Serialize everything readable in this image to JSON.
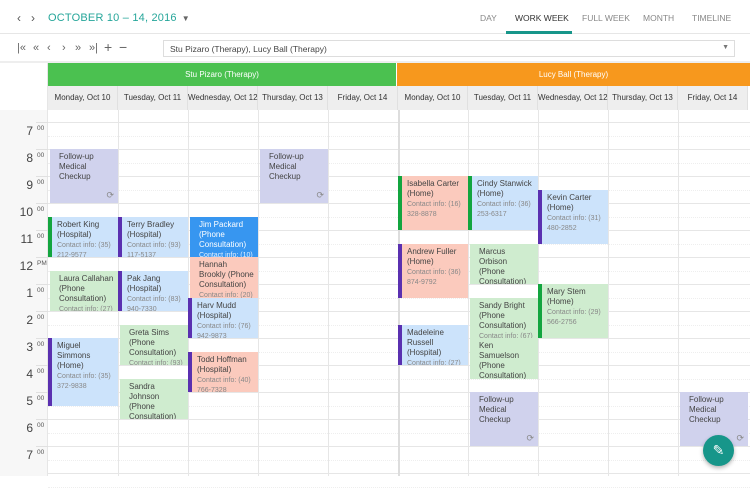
{
  "header": {
    "prev": "‹",
    "next": "›",
    "date_range": "OCTOBER 10 – 14, 2016",
    "views": [
      "DAY",
      "WORK WEEK",
      "FULL WEEK",
      "MONTH",
      "TIMELINE"
    ],
    "active_view": "WORK WEEK"
  },
  "toolbar": {
    "buttons": [
      "first",
      "prev-page",
      "prev",
      "next",
      "next-page",
      "last",
      "zoom-in",
      "zoom-out"
    ],
    "glyphs": [
      "|«",
      "«",
      "‹",
      "›",
      "»",
      "»|",
      "+",
      "−"
    ],
    "resources_value": "Stu Pizaro (Therapy), Lucy Ball (Therapy)"
  },
  "resources": [
    {
      "name": "Stu Pizaro (Therapy)",
      "color": "#4bc150"
    },
    {
      "name": "Lucy Ball (Therapy)",
      "color": "#f7981d"
    }
  ],
  "days": [
    "Monday, Oct 10",
    "Tuesday, Oct 11",
    "Wednesday, Oct 12",
    "Thursday, Oct 13",
    "Friday, Oct 14"
  ],
  "hours": [
    {
      "h": "7",
      "s": "00"
    },
    {
      "h": "8",
      "s": "00"
    },
    {
      "h": "9",
      "s": "00"
    },
    {
      "h": "10",
      "s": "00"
    },
    {
      "h": "11",
      "s": "00"
    },
    {
      "h": "12",
      "s": "PM"
    },
    {
      "h": "1",
      "s": "00"
    },
    {
      "h": "2",
      "s": "00"
    },
    {
      "h": "3",
      "s": "00"
    },
    {
      "h": "4",
      "s": "00"
    },
    {
      "h": "5",
      "s": "00"
    },
    {
      "h": "6",
      "s": "00"
    },
    {
      "h": "7",
      "s": "00"
    }
  ],
  "colors": {
    "blue": "#cce3fb",
    "dark": "#3796f0",
    "green": "#cfeccf",
    "salmon": "#fbcabd",
    "lavender": "#d0d2ed",
    "bar_green": "#13a53f",
    "bar_purple": "#5a30b0"
  },
  "events": [
    {
      "col": 0,
      "start": 8,
      "end": 10,
      "title": "Follow-up Medical Checkup",
      "color": "lavender",
      "recurring": true
    },
    {
      "col": 0,
      "start": 10.5,
      "end": 12,
      "title": "Robert King (Hospital)",
      "contact": "Contact info: (35) 212-9577",
      "color": "blue",
      "bar": "bar_green"
    },
    {
      "col": 0,
      "start": 12.5,
      "end": 14,
      "title": "Laura Callahan (Phone Consultation)",
      "contact": "Contact info: (27)",
      "color": "green"
    },
    {
      "col": 0,
      "start": 15,
      "end": 17.5,
      "title": "Miguel Simmons (Home)",
      "contact": "Contact info: (35) 372-9838",
      "color": "blue",
      "bar": "bar_purple"
    },
    {
      "col": 1,
      "start": 10.5,
      "end": 12,
      "title": "Terry Bradley (Hospital)",
      "contact": "Contact info: (93) 117-5137",
      "color": "blue",
      "bar": "bar_purple"
    },
    {
      "col": 1,
      "start": 12.5,
      "end": 14,
      "title": "Pak Jang (Hospital)",
      "contact": "Contact info: (83) 940-7330",
      "color": "blue",
      "bar": "bar_purple"
    },
    {
      "col": 1,
      "start": 14.5,
      "end": 16,
      "title": "Greta Sims (Phone Consultation)",
      "contact": "Contact info: (93)",
      "color": "green"
    },
    {
      "col": 1,
      "start": 16.5,
      "end": 18,
      "title": "Sandra Johnson (Phone Consultation)",
      "contact": "Contact info: (26)",
      "color": "green"
    },
    {
      "col": 2,
      "start": 10.5,
      "end": 12,
      "title": "Jim Packard (Phone Consultation)",
      "contact": "Contact info: (10)",
      "color": "dark"
    },
    {
      "col": 2,
      "start": 12,
      "end": 13.5,
      "title": "Hannah Brookly (Phone Consultation)",
      "contact": "Contact info: (20)",
      "color": "salmon"
    },
    {
      "col": 2,
      "start": 13.5,
      "end": 15,
      "title": "Harv Mudd (Hospital)",
      "contact": "Contact info: (76) 942-9873",
      "color": "blue",
      "bar": "bar_purple"
    },
    {
      "col": 2,
      "start": 15.5,
      "end": 17,
      "title": "Todd Hoffman (Hospital)",
      "contact": "Contact info: (40) 766-7328",
      "color": "salmon",
      "bar": "bar_purple"
    },
    {
      "col": 3,
      "start": 8,
      "end": 10,
      "title": "Follow-up Medical Checkup",
      "color": "lavender",
      "recurring": true
    },
    {
      "col": 5,
      "start": 9,
      "end": 11,
      "title": "Isabella Carter (Home)",
      "contact": "Contact info: (16) 328-8878",
      "color": "salmon",
      "bar": "bar_green"
    },
    {
      "col": 5,
      "start": 11.5,
      "end": 13.5,
      "title": "Andrew Fuller (Home)",
      "contact": "Contact info: (36) 874-9792",
      "color": "salmon",
      "bar": "bar_purple"
    },
    {
      "col": 5,
      "start": 14.5,
      "end": 16,
      "title": "Madeleine Russell (Hospital)",
      "contact": "Contact info: (27)",
      "color": "blue",
      "bar": "bar_purple"
    },
    {
      "col": 6,
      "start": 9,
      "end": 11,
      "title": "Cindy Stanwick (Home)",
      "contact": "Contact info: (36) 253-6317",
      "color": "blue",
      "bar": "bar_green"
    },
    {
      "col": 6,
      "start": 11.5,
      "end": 13,
      "title": "Marcus Orbison (Phone Consultation)",
      "contact": "Contact info: (66)",
      "color": "green"
    },
    {
      "col": 6,
      "start": 13.5,
      "end": 15,
      "title": "Sandy Bright (Phone Consultation)",
      "contact": "Contact info: (67)",
      "color": "green"
    },
    {
      "col": 6,
      "start": 15,
      "end": 16.5,
      "title": "Ken Samuelson (Phone Consultation)",
      "contact": "Contact info: (24)",
      "color": "green"
    },
    {
      "col": 6,
      "start": 17,
      "end": 19,
      "title": "Follow-up Medical Checkup",
      "color": "lavender",
      "recurring": true
    },
    {
      "col": 7,
      "start": 9.5,
      "end": 11.5,
      "title": "Kevin Carter (Home)",
      "contact": "Contact info: (31) 480-2852",
      "color": "blue",
      "bar": "bar_purple"
    },
    {
      "col": 7,
      "start": 13,
      "end": 15,
      "title": "Mary Stem (Home)",
      "contact": "Contact info: (29) 566-2756",
      "color": "green",
      "bar": "bar_green"
    },
    {
      "col": 9,
      "start": 17,
      "end": 19,
      "title": "Follow-up Medical Checkup",
      "color": "lavender",
      "recurring": true
    }
  ],
  "fab": {
    "icon": "edit-calendar-icon",
    "glyph": "✎"
  }
}
